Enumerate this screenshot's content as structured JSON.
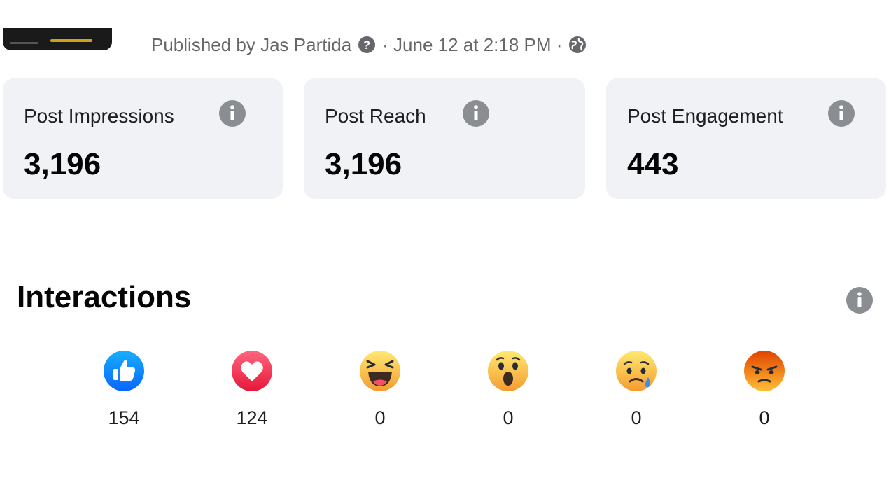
{
  "post": {
    "published_by": "Published by Jas Partida",
    "date": "· June 12 at 2:18 PM ·"
  },
  "stats": [
    {
      "label": "Post Impressions",
      "value": "3,196"
    },
    {
      "label": "Post Reach",
      "value": "3,196"
    },
    {
      "label": "Post Engagement",
      "value": "443"
    }
  ],
  "interactions": {
    "title": "Interactions",
    "reactions": [
      {
        "name": "like-icon",
        "count": "154"
      },
      {
        "name": "love-icon",
        "count": "124"
      },
      {
        "name": "haha-icon",
        "count": "0"
      },
      {
        "name": "wow-icon",
        "count": "0"
      },
      {
        "name": "sad-icon",
        "count": "0"
      },
      {
        "name": "angry-icon",
        "count": "0"
      }
    ]
  },
  "colors": {
    "card_bg": "#f0f2f5",
    "info_icon": "#8a8d91",
    "like_blue": "#1877f2",
    "love_red": "#f33e58",
    "emoji_yellow": "#f7b928",
    "angry_orange": "#e9710f"
  }
}
